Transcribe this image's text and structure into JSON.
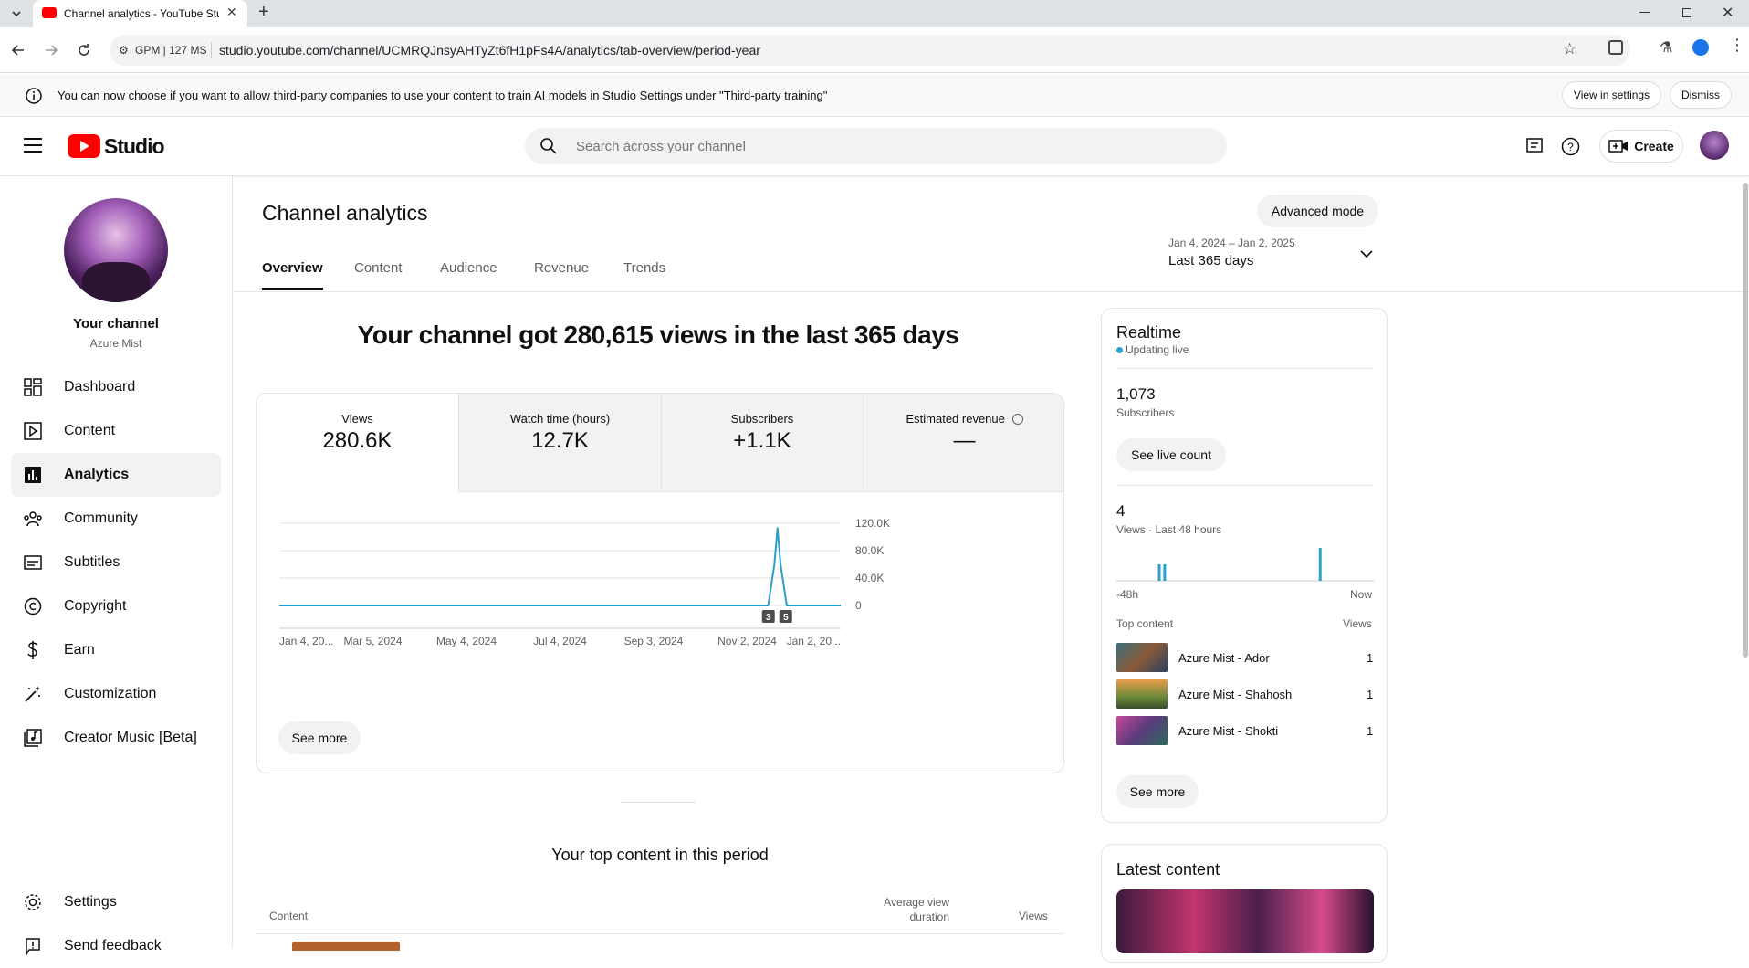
{
  "browser": {
    "tab_title": "Channel analytics - YouTube Studio",
    "tab_title_display": "Channel analytics - YouTube Stu",
    "site_info": "GPM | 127 MS",
    "url": "studio.youtube.com/channel/UCMRQJnsyAHTyZt6fH1pFs4A/analytics/tab-overview/period-year"
  },
  "banner": {
    "text": "You can now choose if you want to allow third-party companies to use your content to train AI models in Studio Settings under \"Third-party training\"",
    "view_settings": "View in settings",
    "dismiss": "Dismiss"
  },
  "header": {
    "logo_text": "Studio",
    "search_placeholder": "Search across your channel",
    "create_label": "Create"
  },
  "sidebar": {
    "channel_title": "Your channel",
    "channel_name": "Azure Mist",
    "items": [
      {
        "label": "Dashboard",
        "icon": "dashboard-icon"
      },
      {
        "label": "Content",
        "icon": "content-icon"
      },
      {
        "label": "Analytics",
        "icon": "analytics-icon"
      },
      {
        "label": "Community",
        "icon": "community-icon"
      },
      {
        "label": "Subtitles",
        "icon": "subtitles-icon"
      },
      {
        "label": "Copyright",
        "icon": "copyright-icon"
      },
      {
        "label": "Earn",
        "icon": "earn-icon"
      },
      {
        "label": "Customization",
        "icon": "customization-icon"
      },
      {
        "label": "Creator Music [Beta]",
        "icon": "music-icon"
      }
    ],
    "settings": "Settings",
    "feedback": "Send feedback"
  },
  "main": {
    "title": "Channel analytics",
    "advanced_mode": "Advanced mode",
    "tabs": [
      "Overview",
      "Content",
      "Audience",
      "Revenue",
      "Trends"
    ],
    "date_range": "Jan 4, 2024 – Jan 2, 2025",
    "period": "Last 365 days",
    "headline": "Your channel got 280,615 views in the last 365 days",
    "metrics": [
      {
        "label": "Views",
        "value": "280.6K"
      },
      {
        "label": "Watch time (hours)",
        "value": "12.7K"
      },
      {
        "label": "Subscribers",
        "value": "+1.1K"
      },
      {
        "label": "Estimated revenue",
        "value": "—"
      }
    ],
    "see_more": "See more",
    "top_content_title": "Your top content in this period",
    "table_headers": {
      "content": "Content",
      "avg_duration_1": "Average view",
      "avg_duration_2": "duration",
      "views": "Views"
    }
  },
  "chart_data": {
    "type": "line",
    "x_tick_labels": [
      "Jan 4, 20...",
      "Mar 5, 2024",
      "May 4, 2024",
      "Jul 4, 2024",
      "Sep 3, 2024",
      "Nov 2, 2024",
      "Jan 2, 20..."
    ],
    "y_tick_labels": [
      "120.0K",
      "80.0K",
      "40.0K",
      "0"
    ],
    "ylim": [
      0,
      120000
    ],
    "series": [
      {
        "x": [
          "2024-01-04",
          "2024-11-16",
          "2024-11-20",
          "2024-11-22",
          "2024-11-24",
          "2024-11-28",
          "2025-01-02"
        ],
        "values": [
          0,
          0,
          60000,
          113000,
          60000,
          0,
          0
        ]
      }
    ],
    "markers": [
      "3",
      "5"
    ],
    "line_color": "#2c9fc9",
    "grid": true
  },
  "realtime": {
    "title": "Realtime",
    "status": "Updating live",
    "subscribers_value": "1,073",
    "subscribers_label": "Subscribers",
    "see_live_count": "See live count",
    "views_value": "4",
    "views_label": "Views · Last 48 hours",
    "axis_start": "-48h",
    "axis_end": "Now",
    "bars": [
      {
        "hour": -40,
        "views": 1
      },
      {
        "hour": -39,
        "views": 1
      },
      {
        "hour": -10,
        "views": 2
      }
    ],
    "top_content_label": "Top content",
    "views_col": "Views",
    "top_items": [
      {
        "title": "Azure Mist - Ador",
        "views": "1"
      },
      {
        "title": "Azure Mist - Shahosh",
        "views": "1"
      },
      {
        "title": "Azure Mist - Shokti",
        "views": "1"
      }
    ],
    "see_more": "See more"
  },
  "latest": {
    "title": "Latest content"
  }
}
